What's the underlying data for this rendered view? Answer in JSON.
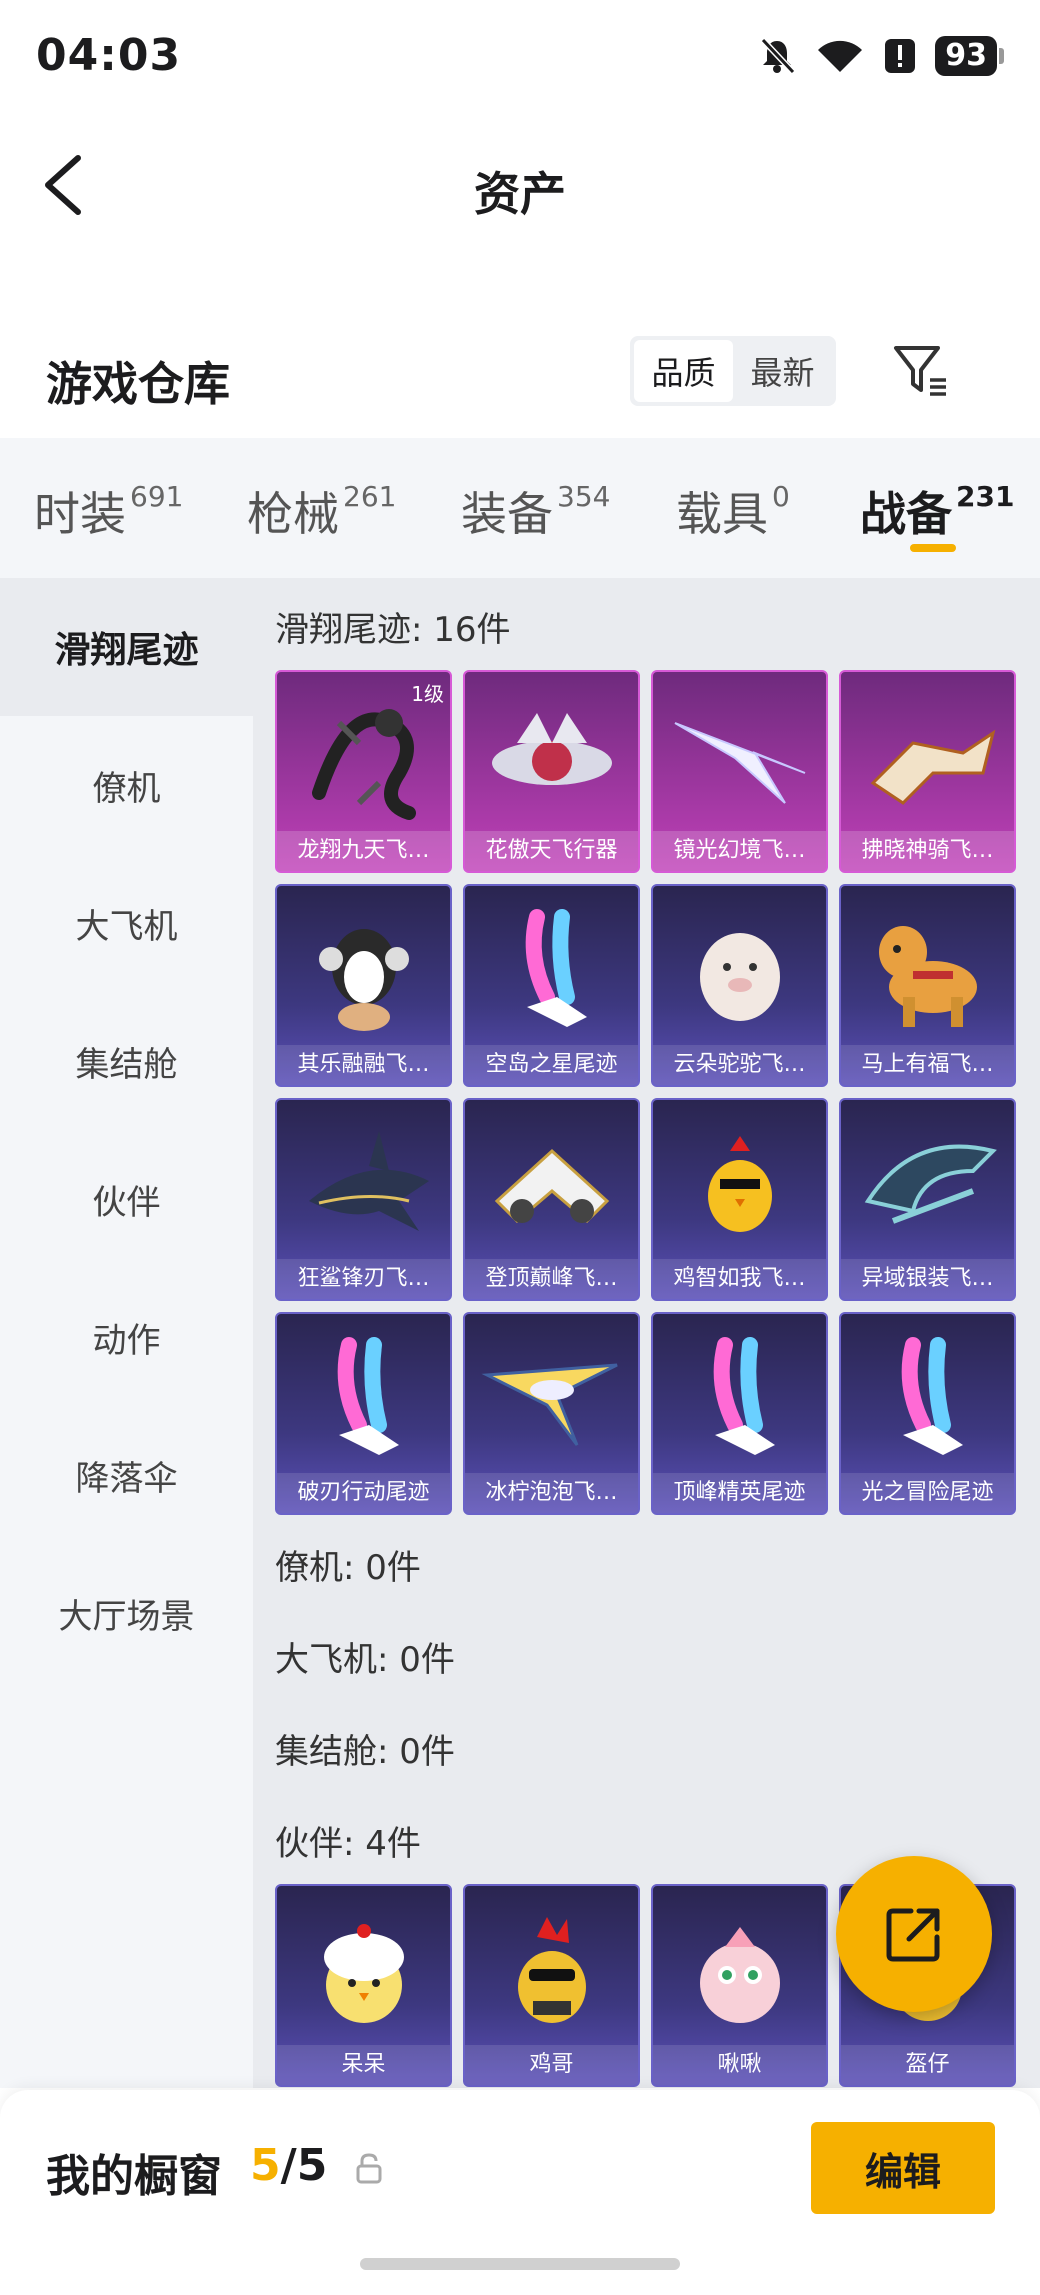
{
  "status_bar": {
    "time": "04:03",
    "battery": "93"
  },
  "header": {
    "title": "资产"
  },
  "warehouse": {
    "title": "游戏仓库",
    "sort_options": [
      "品质",
      "最新"
    ],
    "active_sort": "品质"
  },
  "tabs": [
    {
      "label": "时装",
      "count": "691"
    },
    {
      "label": "枪械",
      "count": "261"
    },
    {
      "label": "装备",
      "count": "354"
    },
    {
      "label": "载具",
      "count": "0"
    },
    {
      "label": "战备",
      "count": "231",
      "active": true
    }
  ],
  "sidebar": [
    "滑翔尾迹",
    "僚机",
    "大飞机",
    "集结舱",
    "伙伴",
    "动作",
    "降落伞",
    "大厅场景"
  ],
  "sections": {
    "glide": {
      "label": "滑翔尾迹: 16件",
      "items": [
        {
          "name": "龙翔九天飞…",
          "rarity": "purple",
          "badge": "1级",
          "icon": "dragon-icon"
        },
        {
          "name": "花傲天飞行器",
          "rarity": "purple",
          "icon": "aircraft-icon"
        },
        {
          "name": "镜光幻境飞…",
          "rarity": "purple",
          "icon": "wing-icon"
        },
        {
          "name": "拂晓神骑飞…",
          "rarity": "purple",
          "icon": "mech-icon"
        },
        {
          "name": "其乐融融飞…",
          "rarity": "blue",
          "icon": "penguin-icon"
        },
        {
          "name": "空岛之星尾迹",
          "rarity": "blue",
          "icon": "smoke-trail-icon"
        },
        {
          "name": "云朵驼驼飞…",
          "rarity": "blue",
          "icon": "alpaca-icon"
        },
        {
          "name": "马上有福飞…",
          "rarity": "blue",
          "icon": "horse-icon"
        },
        {
          "name": "狂鲨锋刃飞…",
          "rarity": "blue",
          "icon": "shark-icon"
        },
        {
          "name": "登顶巅峰飞…",
          "rarity": "blue",
          "icon": "jet-icon"
        },
        {
          "name": "鸡智如我飞…",
          "rarity": "blue",
          "icon": "chicken-icon"
        },
        {
          "name": "异域银装飞…",
          "rarity": "blue",
          "icon": "silver-wing-icon"
        },
        {
          "name": "破刃行动尾迹",
          "rarity": "blue",
          "icon": "smoke-trail-icon"
        },
        {
          "name": "冰柠泡泡飞…",
          "rarity": "blue",
          "icon": "glider-icon"
        },
        {
          "name": "顶峰精英尾迹",
          "rarity": "blue",
          "icon": "smoke-trail-icon"
        },
        {
          "name": "光之冒险尾迹",
          "rarity": "blue",
          "icon": "smoke-trail-icon"
        }
      ]
    },
    "wingman": {
      "label": "僚机: 0件"
    },
    "bigplane": {
      "label": "大飞机: 0件"
    },
    "capsule": {
      "label": "集结舱: 0件"
    },
    "partner": {
      "label": "伙伴: 4件",
      "items": [
        {
          "name": "呆呆",
          "icon": "chick-icon"
        },
        {
          "name": "鸡哥",
          "icon": "rooster-icon"
        },
        {
          "name": "啾啾",
          "icon": "pink-bird-icon"
        },
        {
          "name": "盔仔",
          "icon": "helmet-chick-icon"
        }
      ]
    }
  },
  "bottom": {
    "showcase_label": "我的橱窗",
    "current": "5",
    "total": "/5",
    "edit_label": "编辑"
  },
  "colors": {
    "accent": "#f6b000",
    "purple_card": "#c040b8",
    "blue_card": "#3d3880"
  }
}
